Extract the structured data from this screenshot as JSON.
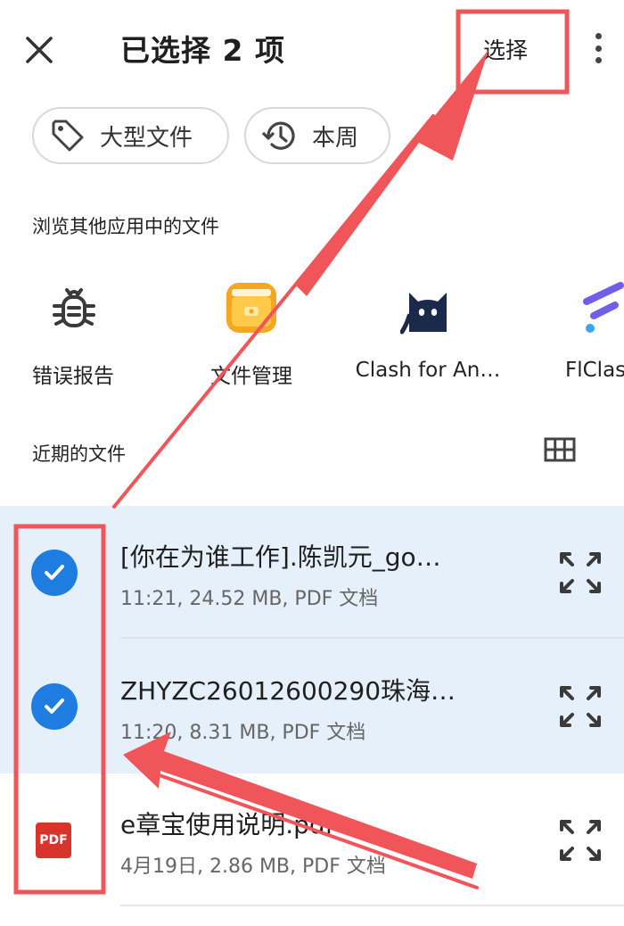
{
  "header": {
    "title": "已选择 2 项",
    "select_label": "选择",
    "close_icon": "close-icon",
    "more_icon": "more-vert-icon"
  },
  "chips": [
    {
      "label": "大型文件",
      "icon": "tag-icon"
    },
    {
      "label": "本周",
      "icon": "history-icon"
    }
  ],
  "browse_section": {
    "title": "浏览其他应用中的文件",
    "apps": [
      {
        "label": "错误报告",
        "icon": "bug-icon"
      },
      {
        "label": "文件管理",
        "icon": "folder-wallet-icon"
      },
      {
        "label": "Clash for An…",
        "icon": "black-cat-icon"
      },
      {
        "label": "FlClas",
        "icon": "flclash-icon"
      }
    ]
  },
  "recent_section": {
    "title": "近期的文件",
    "view_toggle_icon": "grid-view-icon"
  },
  "files": [
    {
      "name": "[你在为谁工作].陈凯元_go…",
      "meta": "11:21, 24.52 MB, PDF 文档",
      "selected": true
    },
    {
      "name": "ZHYZC26012600290珠海…",
      "meta": "11:20, 8.31 MB, PDF 文档",
      "selected": true
    },
    {
      "name": "e章宝使用说明.pdf",
      "meta": "4月19日, 2.86 MB, PDF 文档",
      "selected": false,
      "thumb_label": "PDF"
    }
  ],
  "colors": {
    "selected_row_bg": "#e6f0fa",
    "check_blue": "#1f7ce0",
    "annotation_red": "#f0555a",
    "pdf_red": "#d8342c"
  }
}
